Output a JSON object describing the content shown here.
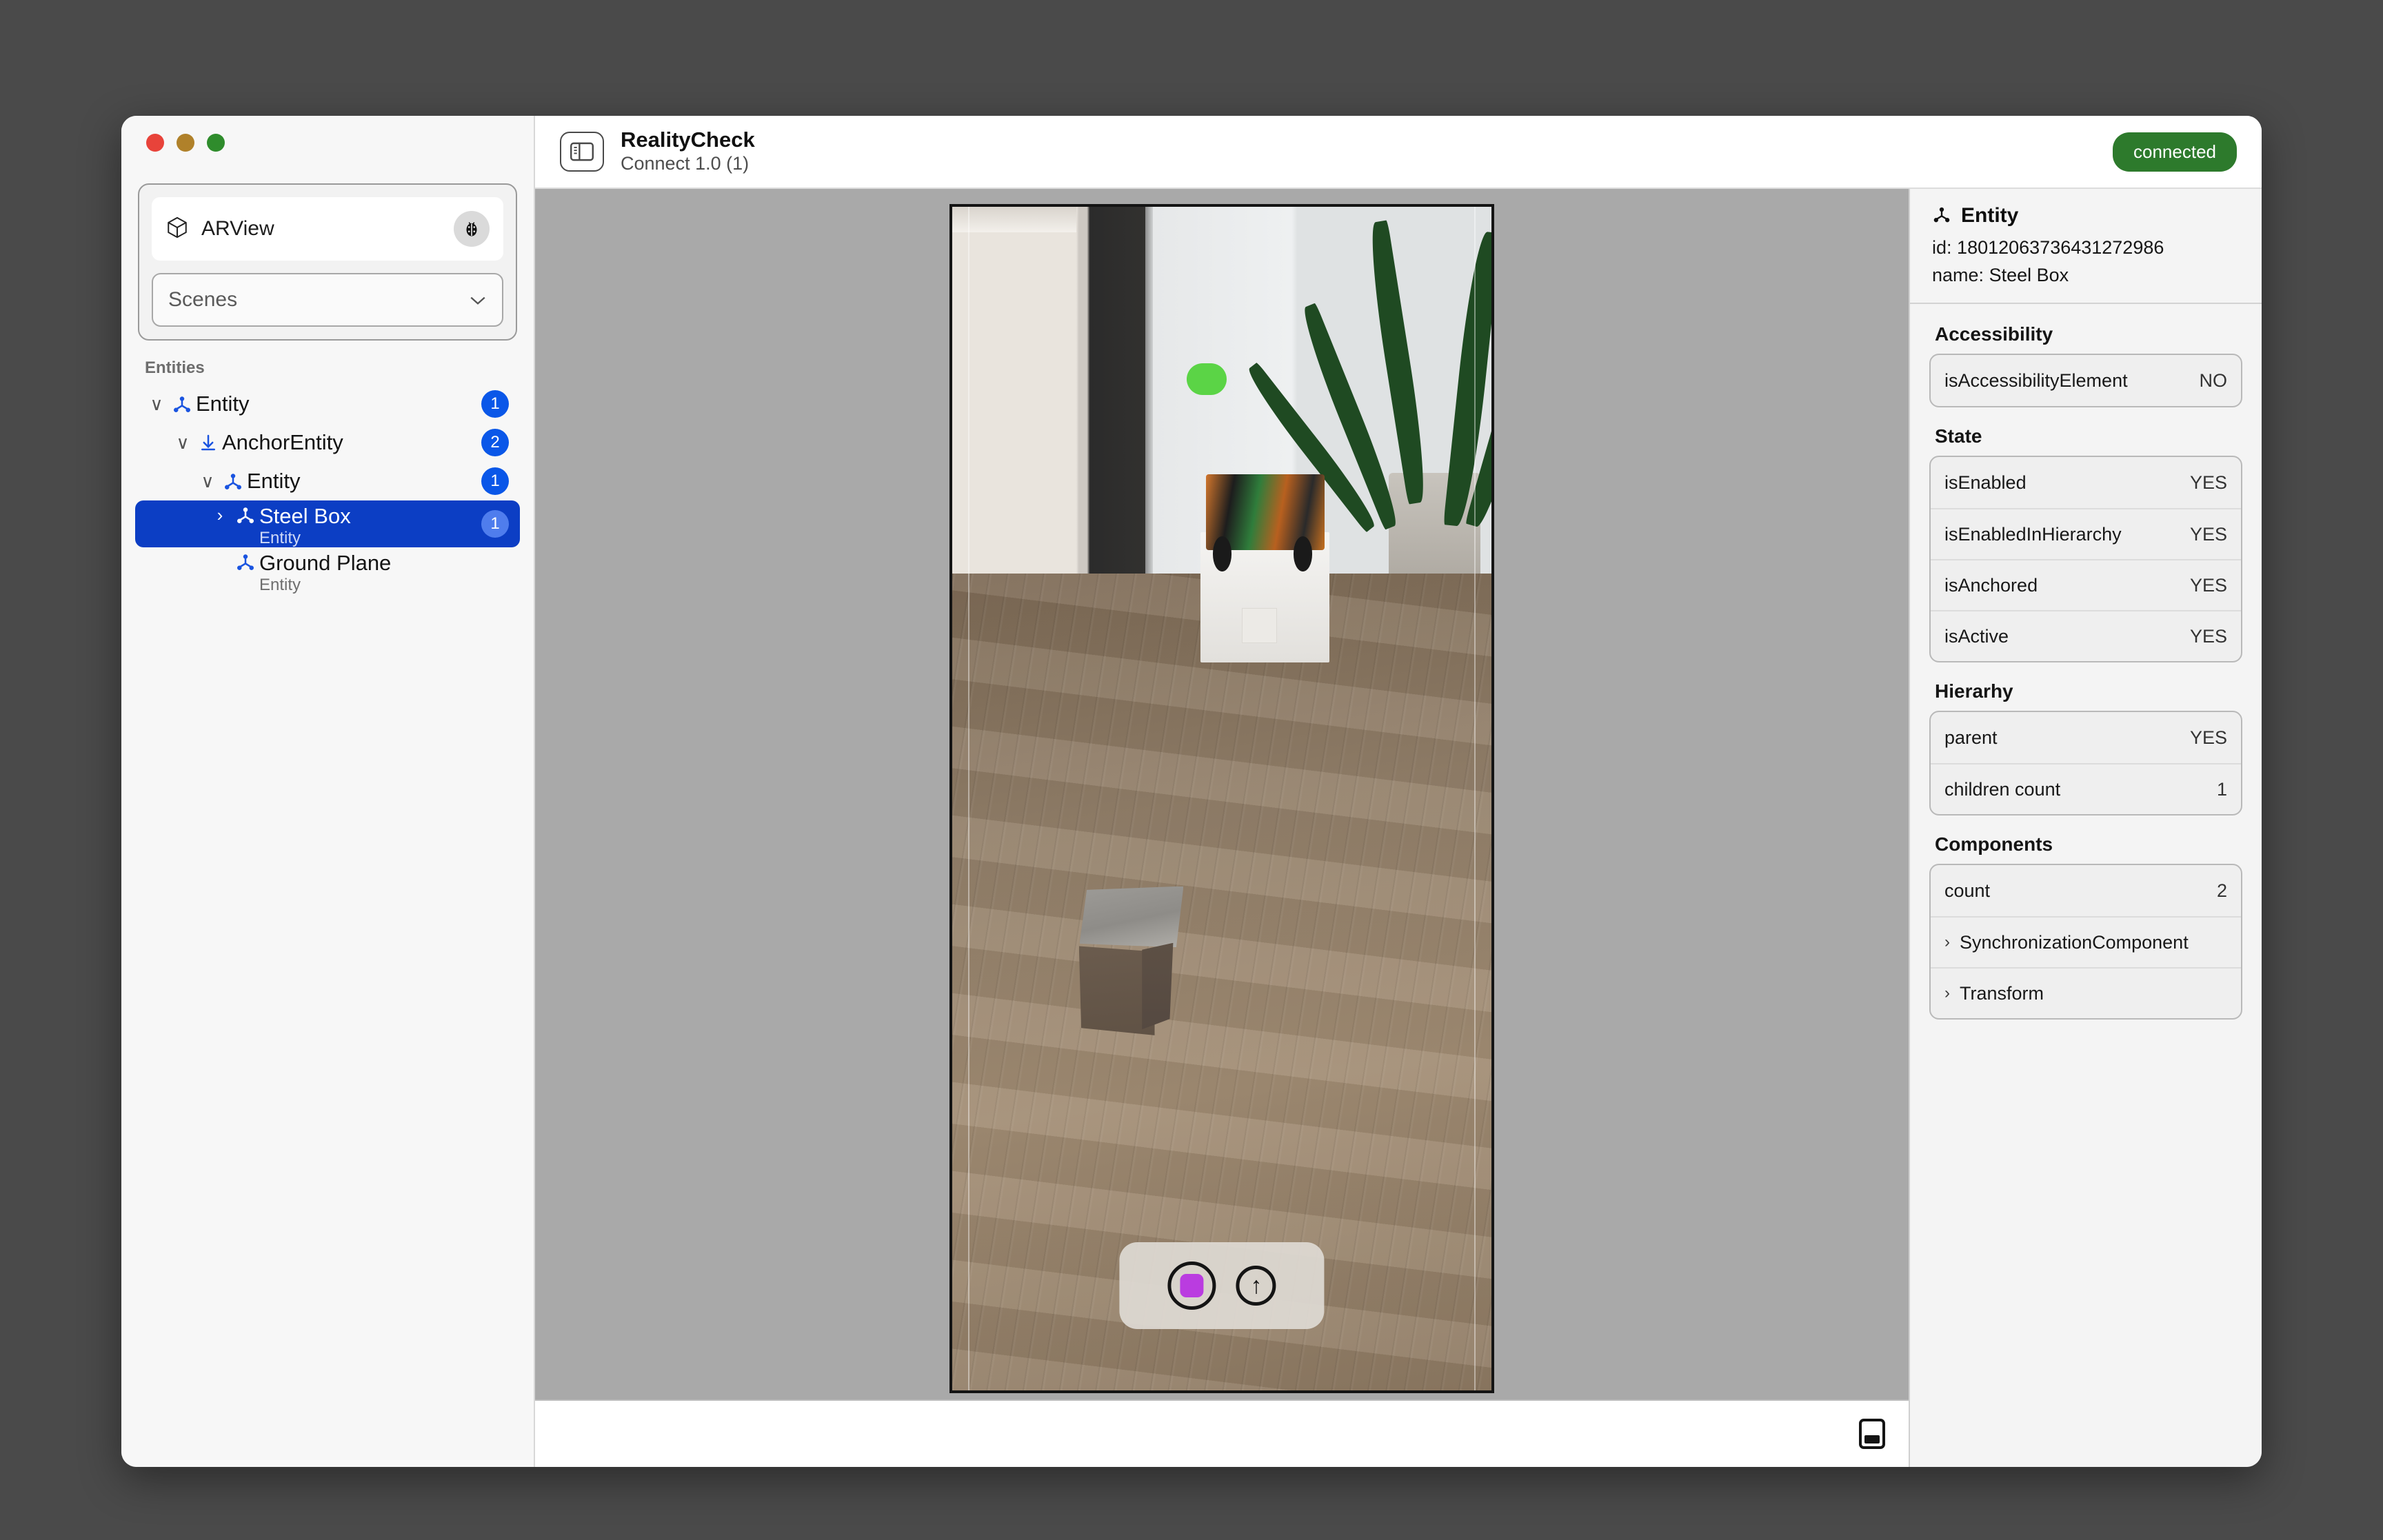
{
  "window": {
    "traffic_lights": [
      "close",
      "minimize",
      "zoom"
    ]
  },
  "sidebar": {
    "device_card": {
      "icon": "cube-3d-icon",
      "label": "ARView",
      "debug_icon": "ladybug-icon"
    },
    "scene_select": {
      "value": "Scenes",
      "chevron": "chevron-down-icon"
    },
    "section_label": "Entities",
    "tree": [
      {
        "twisty": "∨",
        "icon": "entity-axes-icon",
        "title": "Entity",
        "subtitle": "",
        "badge": "1",
        "depth": 0,
        "selected": false
      },
      {
        "twisty": "∨",
        "icon": "anchor-arrow-icon",
        "title": "AnchorEntity",
        "subtitle": "",
        "badge": "2",
        "depth": 1,
        "selected": false
      },
      {
        "twisty": "∨",
        "icon": "entity-axes-icon",
        "title": "Entity",
        "subtitle": "",
        "badge": "1",
        "depth": 2,
        "selected": false
      },
      {
        "twisty": "›",
        "icon": "entity-axes-icon",
        "title": "Steel Box",
        "subtitle": "Entity",
        "badge": "1",
        "depth": 3,
        "selected": true
      },
      {
        "twisty": "",
        "icon": "entity-axes-icon",
        "title": "Ground Plane",
        "subtitle": "Entity",
        "badge": "",
        "depth": 3,
        "selected": false
      }
    ]
  },
  "topbar": {
    "panel_toggle_icon": "sidebar-toggle-icon",
    "app_title": "RealityCheck",
    "app_subtitle": "Connect 1.0 (1)",
    "status": "connected",
    "status_color": "#2d7a2c"
  },
  "stage": {
    "ar_controls": {
      "record_button": "record-stop-button",
      "record_color": "#ba3ce0",
      "share_button": "share-up-arrow-button",
      "share_glyph": "↑"
    },
    "overlay_marker_color": "#5bd446"
  },
  "inspector": {
    "icon": "entity-axes-icon",
    "title": "Entity",
    "id_label": "id:",
    "id_value": "18012063736431272986",
    "name_label": "name:",
    "name_value": "Steel Box",
    "sections": [
      {
        "title": "Accessibility",
        "rows": [
          {
            "label": "isAccessibilityElement",
            "value": "NO",
            "chevron": ""
          }
        ]
      },
      {
        "title": "State",
        "rows": [
          {
            "label": "isEnabled",
            "value": "YES",
            "chevron": ""
          },
          {
            "label": "isEnabledInHierarchy",
            "value": "YES",
            "chevron": ""
          },
          {
            "label": "isAnchored",
            "value": "YES",
            "chevron": ""
          },
          {
            "label": "isActive",
            "value": "YES",
            "chevron": ""
          }
        ]
      },
      {
        "title": "Hierarhy",
        "rows": [
          {
            "label": "parent",
            "value": "YES",
            "chevron": ""
          },
          {
            "label": "children count",
            "value": "1",
            "chevron": ""
          }
        ]
      },
      {
        "title": "Components",
        "rows": [
          {
            "label": "count",
            "value": "2",
            "chevron": ""
          },
          {
            "label": "SynchronizationComponent",
            "value": "",
            "chevron": "›"
          },
          {
            "label": "Transform",
            "value": "",
            "chevron": "›"
          }
        ]
      }
    ]
  },
  "bottombar": {
    "icon": "bottom-panel-toggle-icon"
  }
}
